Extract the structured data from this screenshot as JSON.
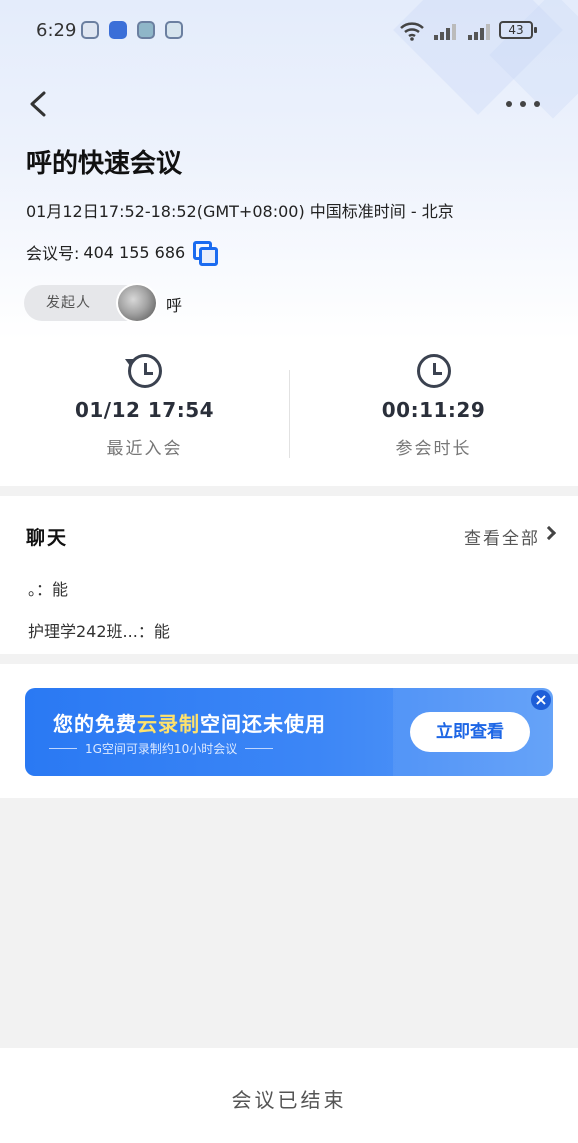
{
  "status_bar": {
    "time": "6:29",
    "battery": "43",
    "notification_icons": [
      "app-icon",
      "app-icon",
      "app-icon",
      "app-icon"
    ]
  },
  "header": {
    "title": "呼的快速会议",
    "time_range": "01月12日17:52-18:52(GMT+08:00) 中国标准时间 - 北京",
    "meeting_id_label": "会议号: ",
    "meeting_id": "404 155 686",
    "host_label": "发起人",
    "host_name": "呼"
  },
  "stats": {
    "last_join_value": "01/12 17:54",
    "last_join_label": "最近入会",
    "duration_value": "00:11:29",
    "duration_label": "参会时长"
  },
  "chat": {
    "title": "聊天",
    "view_all": "查看全部",
    "messages": [
      {
        "sender": "。",
        "text": "能"
      },
      {
        "sender": "护理学242班...",
        "text": "能"
      }
    ]
  },
  "promo": {
    "main_prefix": "您的免费",
    "main_highlight": "云录制",
    "main_suffix": "空间还未使用",
    "sub": "1G空间可录制约10小时会议",
    "button": "立即查看",
    "close": "×"
  },
  "footer": {
    "status": "会议已结束"
  },
  "colors": {
    "accent": "#1a6bf0",
    "banner": "#2a79f3",
    "highlight": "#ffe26b"
  }
}
